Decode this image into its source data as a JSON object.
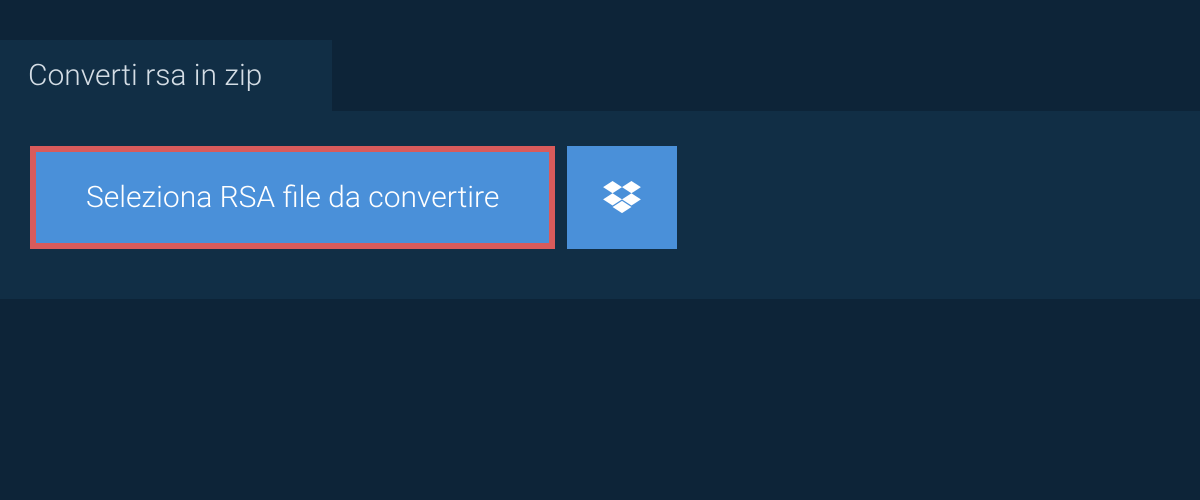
{
  "header": {
    "tab_title": "Converti rsa in zip"
  },
  "actions": {
    "select_file_label": "Seleziona RSA file da convertire"
  },
  "colors": {
    "background": "#0d2438",
    "panel": "#112e45",
    "button": "#4a90d9",
    "highlight_border": "#d95b5b",
    "text_light": "#d4dde5",
    "text_white": "#ffffff"
  }
}
